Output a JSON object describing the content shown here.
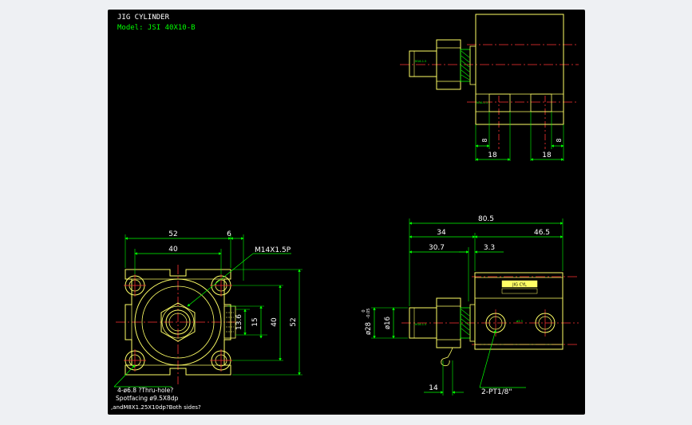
{
  "header": {
    "title": "JIG CYLINDER",
    "model": "Model: JSI 40X10-B"
  },
  "colors": {
    "background": "#000000",
    "page": "#eef0f3",
    "outline": "#ffff66",
    "dimension": "#00ff00",
    "centerline": "#ff3333",
    "text": "#ffffff"
  },
  "front_view": {
    "dim_outer_width": "52",
    "dim_offset": "6",
    "dim_bolt_spacing": "40",
    "thread_label": "M14X1.5P",
    "dim_13_6": "13.6",
    "dim_15": "15",
    "dim_40_vertical": "40",
    "dim_52_vertical": "52",
    "note_line1": "4-ø6.8 ?Thru-hole?",
    "note_line2": "Spotfacing  ø9.5X8dp",
    "note_line3": ",andM8X1.25X10dp?Both sides?"
  },
  "side_view": {
    "dim_total": "80.5",
    "dim_34": "34",
    "dim_46_5": "46.5",
    "dim_30_7": "30.7",
    "dim_3_3": "3.3",
    "dim_rod_diameter": "ø16",
    "dim_body_diameter": "ø28",
    "dim_body_tol_upper": "0",
    "dim_body_tol_lower": "-0.05",
    "dim_14": "14",
    "port_label": "2-PT1/8\"",
    "small_label_a": "M16-1.5",
    "small_label_b": "ø3.3",
    "plate_text": "JIG CYL"
  },
  "top_view": {
    "dim_left_8": "8",
    "dim_right_8": "8",
    "dim_left_18": "18",
    "dim_right_18": "18",
    "small_label": "M16-1.5"
  }
}
